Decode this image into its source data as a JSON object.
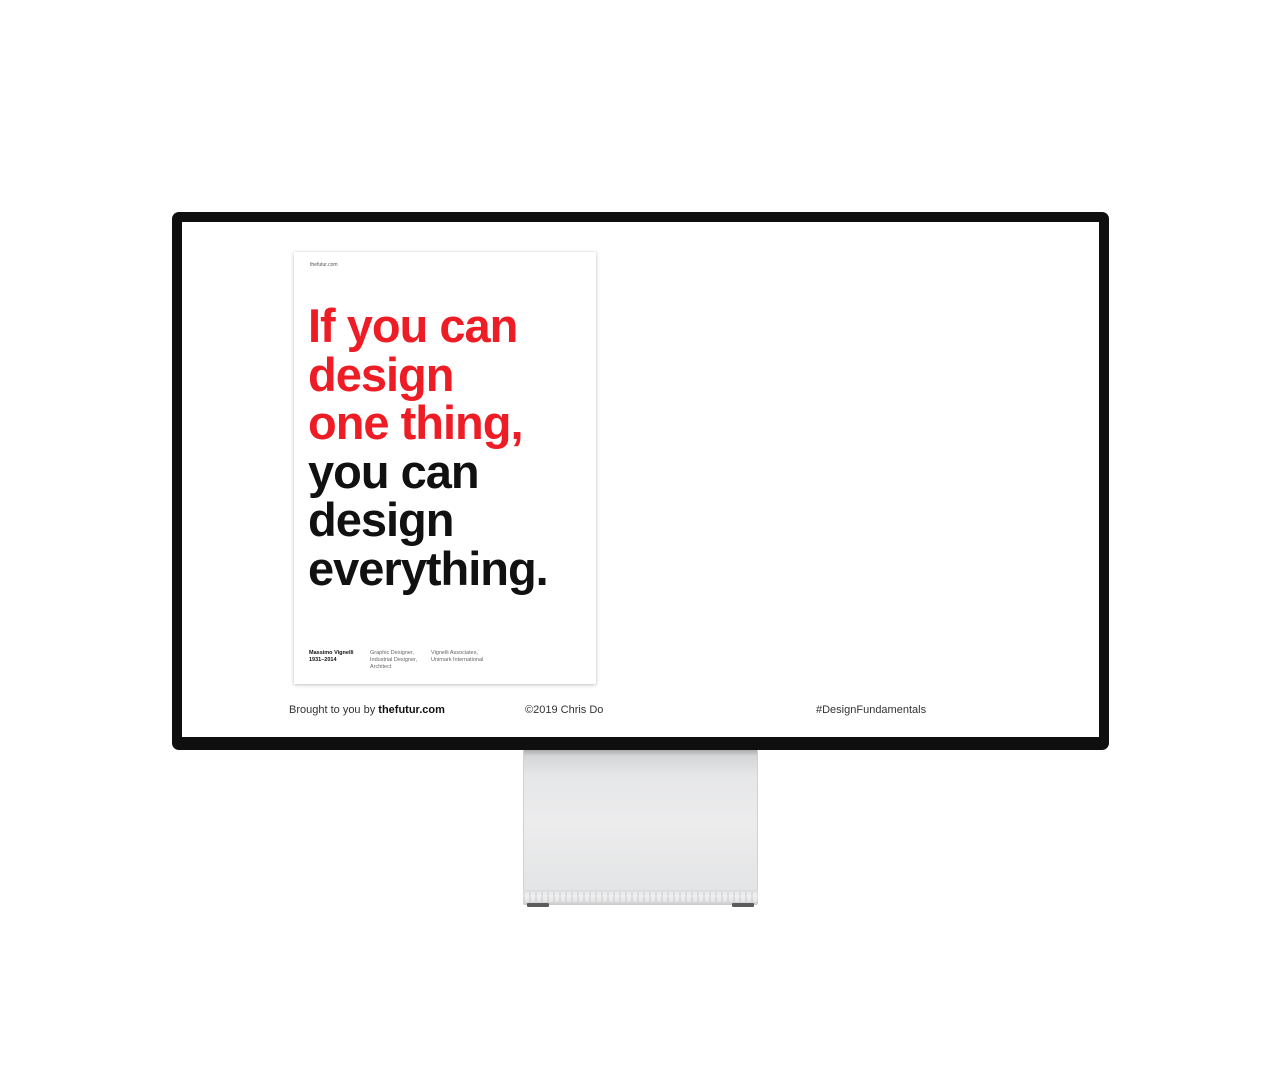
{
  "poster": {
    "site": "thefutur.com",
    "quote_red": [
      "If you can",
      "design",
      "one thing,"
    ],
    "quote_black": [
      "you can",
      "design",
      "everything."
    ],
    "author_name": "Massimo Vignelli",
    "author_years": "1931–2014",
    "roles": [
      "Graphic Designer,",
      "Industrial Designer,",
      "Architect"
    ],
    "orgs": [
      "Vignelli Associates,",
      "Unimark International"
    ]
  },
  "footer": {
    "brought_prefix": "Brought to you by ",
    "brought_brand": "thefutur.com",
    "copyright": "©2019 Chris Do",
    "hashtag": "#DesignFundamentals"
  },
  "colors": {
    "accent_red": "#ee1c24",
    "text_black": "#111111",
    "bezel": "#0f0f0f",
    "stand_silver": "#e6e7e8"
  }
}
